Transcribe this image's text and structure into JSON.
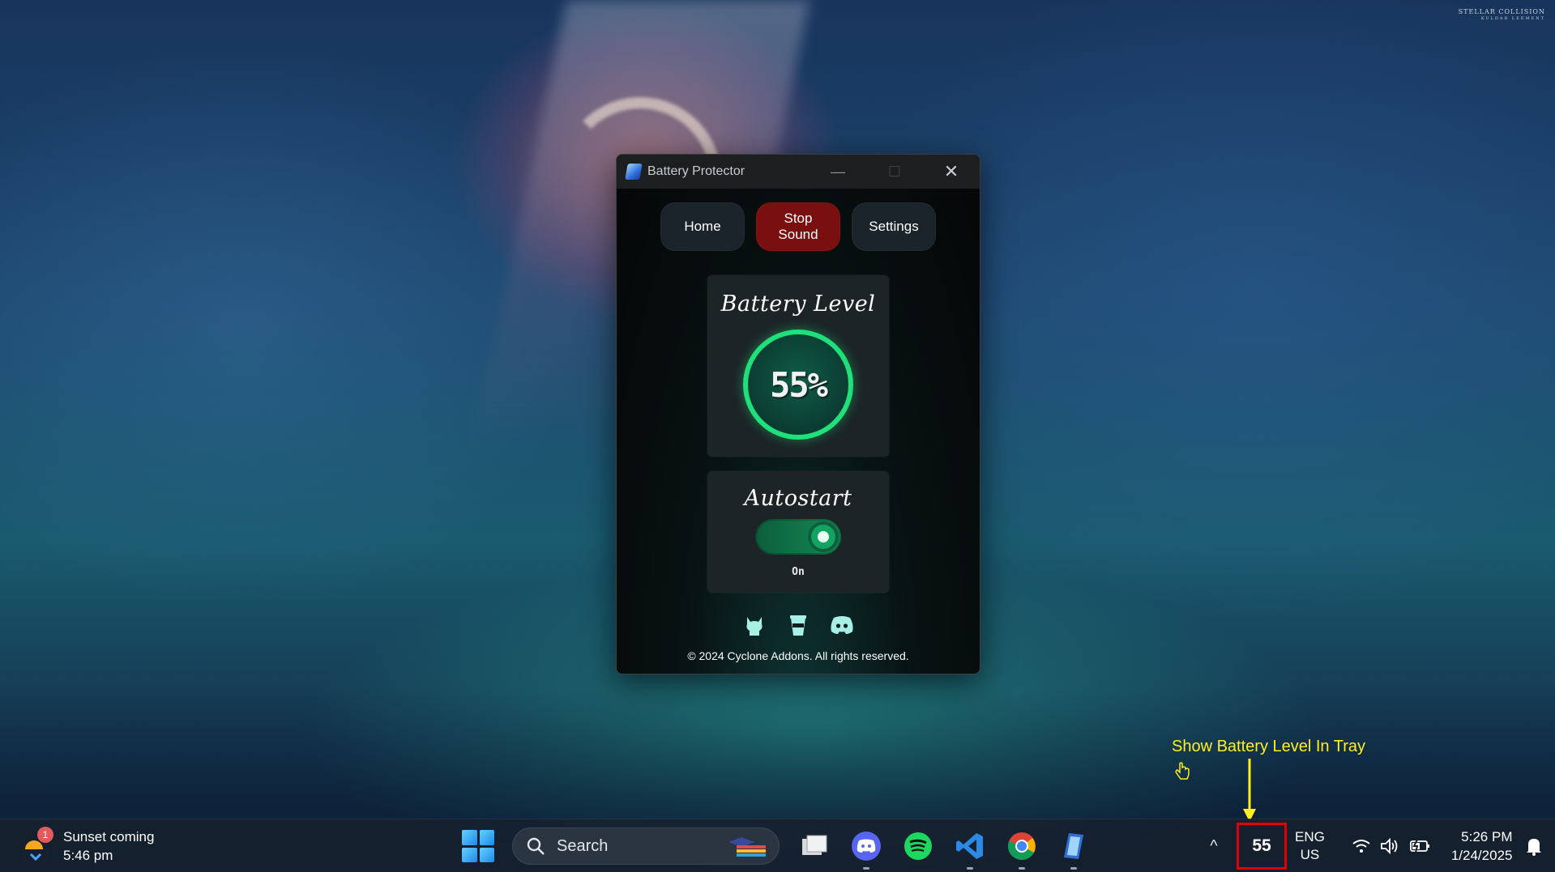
{
  "desktop": {
    "watermark_line1": "STELLAR COLLISION",
    "watermark_line2": "KULDAR LEEMENT"
  },
  "window": {
    "title": "Battery Protector",
    "minimize_glyph": "—",
    "maximize_glyph": "☐",
    "close_glyph": "✕"
  },
  "nav": {
    "home_label": "Home",
    "stop_sound_label": "Stop Sound",
    "settings_label": "Settings"
  },
  "battery": {
    "title": "Battery Level",
    "level_text": "55%",
    "level_percent": 55
  },
  "autostart": {
    "title": "Autostart",
    "state_label": "On",
    "enabled": true
  },
  "socials": [
    "github-icon",
    "coffee-cup-icon",
    "discord-icon"
  ],
  "footer": {
    "copyright": "© 2024 Cyclone Addons. All rights reserved."
  },
  "annotation": {
    "text": "Show Battery Level In Tray"
  },
  "taskbar": {
    "weather": {
      "badge": "1",
      "line1": "Sunset coming",
      "line2": "5:46 pm"
    },
    "search_label": "Search",
    "apps": [
      "file-explorer-icon",
      "discord-icon",
      "spotify-icon",
      "vscode-icon",
      "chrome-icon",
      "battery-protector-icon"
    ],
    "tray": {
      "chevron": "^",
      "battery_value": "55",
      "lang_line1": "ENG",
      "lang_line2": "US",
      "time": "5:26 PM",
      "date": "1/24/2025"
    }
  },
  "colors": {
    "accent_green": "#1fe07a",
    "stop_red": "#7a0f0f",
    "annotation_yellow": "#ffee22",
    "highlight_red": "#e00000"
  }
}
